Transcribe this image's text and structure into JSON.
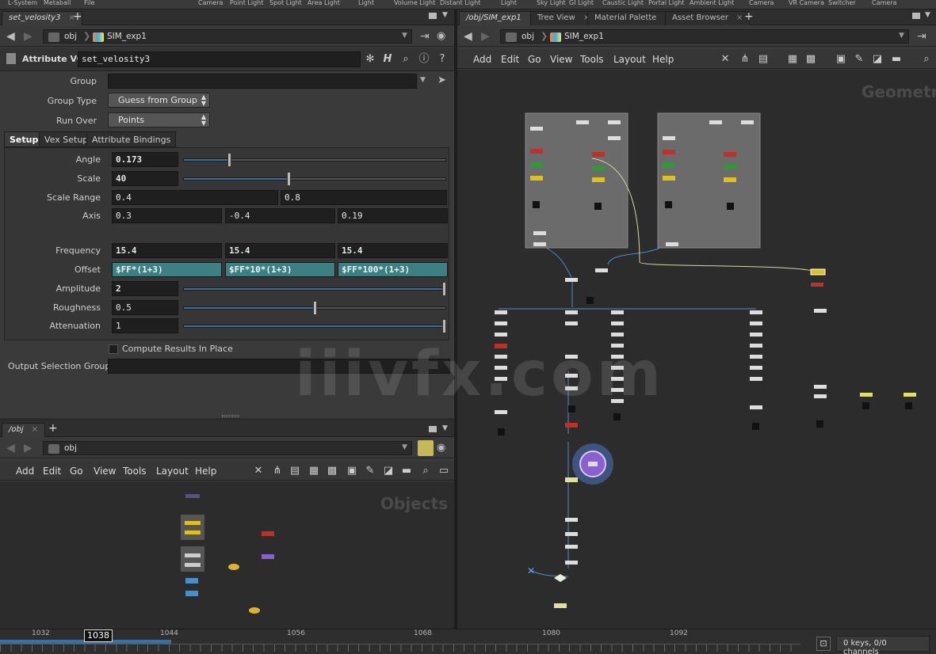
{
  "shelf": {
    "tools": [
      "L-System",
      "Metaball",
      "File",
      "Camera",
      "Point Light",
      "Spot Light",
      "Area Light",
      "Light",
      "Volume Light",
      "Distant Light",
      "Light",
      "Sky Light",
      "GI Light",
      "Caustic Light",
      "Portal Light",
      "Ambient Light",
      "Camera",
      "VR Camera",
      "Switcher",
      "Camera"
    ]
  },
  "left_top": {
    "tab": "set_velosity3",
    "path": {
      "obj": "obj",
      "node": "SIM_exp1"
    },
    "node_type": "Attribute VOP",
    "node_name": "set_velosity3",
    "params": {
      "group_label": "Group",
      "group_value": "",
      "group_type_label": "Group Type",
      "group_type_value": "Guess from Group",
      "run_over_label": "Run Over",
      "run_over_value": "Points",
      "subtabs": [
        "Setup",
        "Vex Setup",
        "Attribute Bindings"
      ],
      "angle_label": "Angle",
      "angle_value": "0.173",
      "angle_fraction": 0.17,
      "scale_label": "Scale",
      "scale_value": "40",
      "scale_fraction": 0.4,
      "scale_range_label": "Scale Range",
      "scale_range": [
        "0.4",
        "0.8"
      ],
      "axis_label": "Axis",
      "axis": [
        "0.3",
        "-0.4",
        "0.19"
      ],
      "frequency_label": "Frequency",
      "frequency": [
        "15.4",
        "15.4",
        "15.4"
      ],
      "offset_label": "Offset",
      "offset": [
        "$FF*(1+3)",
        "$FF*10*(1+3)",
        "$FF*100*(1+3)"
      ],
      "amplitude_label": "Amplitude",
      "amplitude_value": "2",
      "amplitude_fraction": 1.0,
      "roughness_label": "Roughness",
      "roughness_value": "0.5",
      "roughness_fraction": 0.5,
      "attenuation_label": "Attenuation",
      "attenuation_value": "1",
      "attenuation_fraction": 1.0,
      "compute_label": "Compute Results In Place",
      "output_group_label": "Output Selection Group",
      "output_group_value": ""
    }
  },
  "left_bottom": {
    "tab": "/obj",
    "path": "obj",
    "menu": [
      "Add",
      "Edit",
      "Go",
      "View",
      "Tools",
      "Layout",
      "Help"
    ],
    "canvas_title": "Objects"
  },
  "right": {
    "tabs": [
      "/obj/SIM_exp1",
      "Tree View",
      "Material Palette",
      "Asset Browser"
    ],
    "path": {
      "obj": "obj",
      "node": "SIM_exp1"
    },
    "menu": [
      "Add",
      "Edit",
      "Go",
      "View",
      "Tools",
      "Layout",
      "Help"
    ],
    "canvas_title": "Geometr"
  },
  "watermark": "iiivfx.com",
  "timeline": {
    "ticks": [
      "1032",
      "1044",
      "1056",
      "1068",
      "1080",
      "1092"
    ],
    "current_frame": "1038",
    "keys_status": "0 keys, 0/0 channels"
  },
  "colors": {
    "accent_blue": "#3f6e9b",
    "expr_teal": "#3d7f82",
    "node_red": "#c0302a",
    "node_green": "#2f9a35",
    "node_yellow": "#e0c020",
    "node_purple": "#8a5fd0"
  }
}
